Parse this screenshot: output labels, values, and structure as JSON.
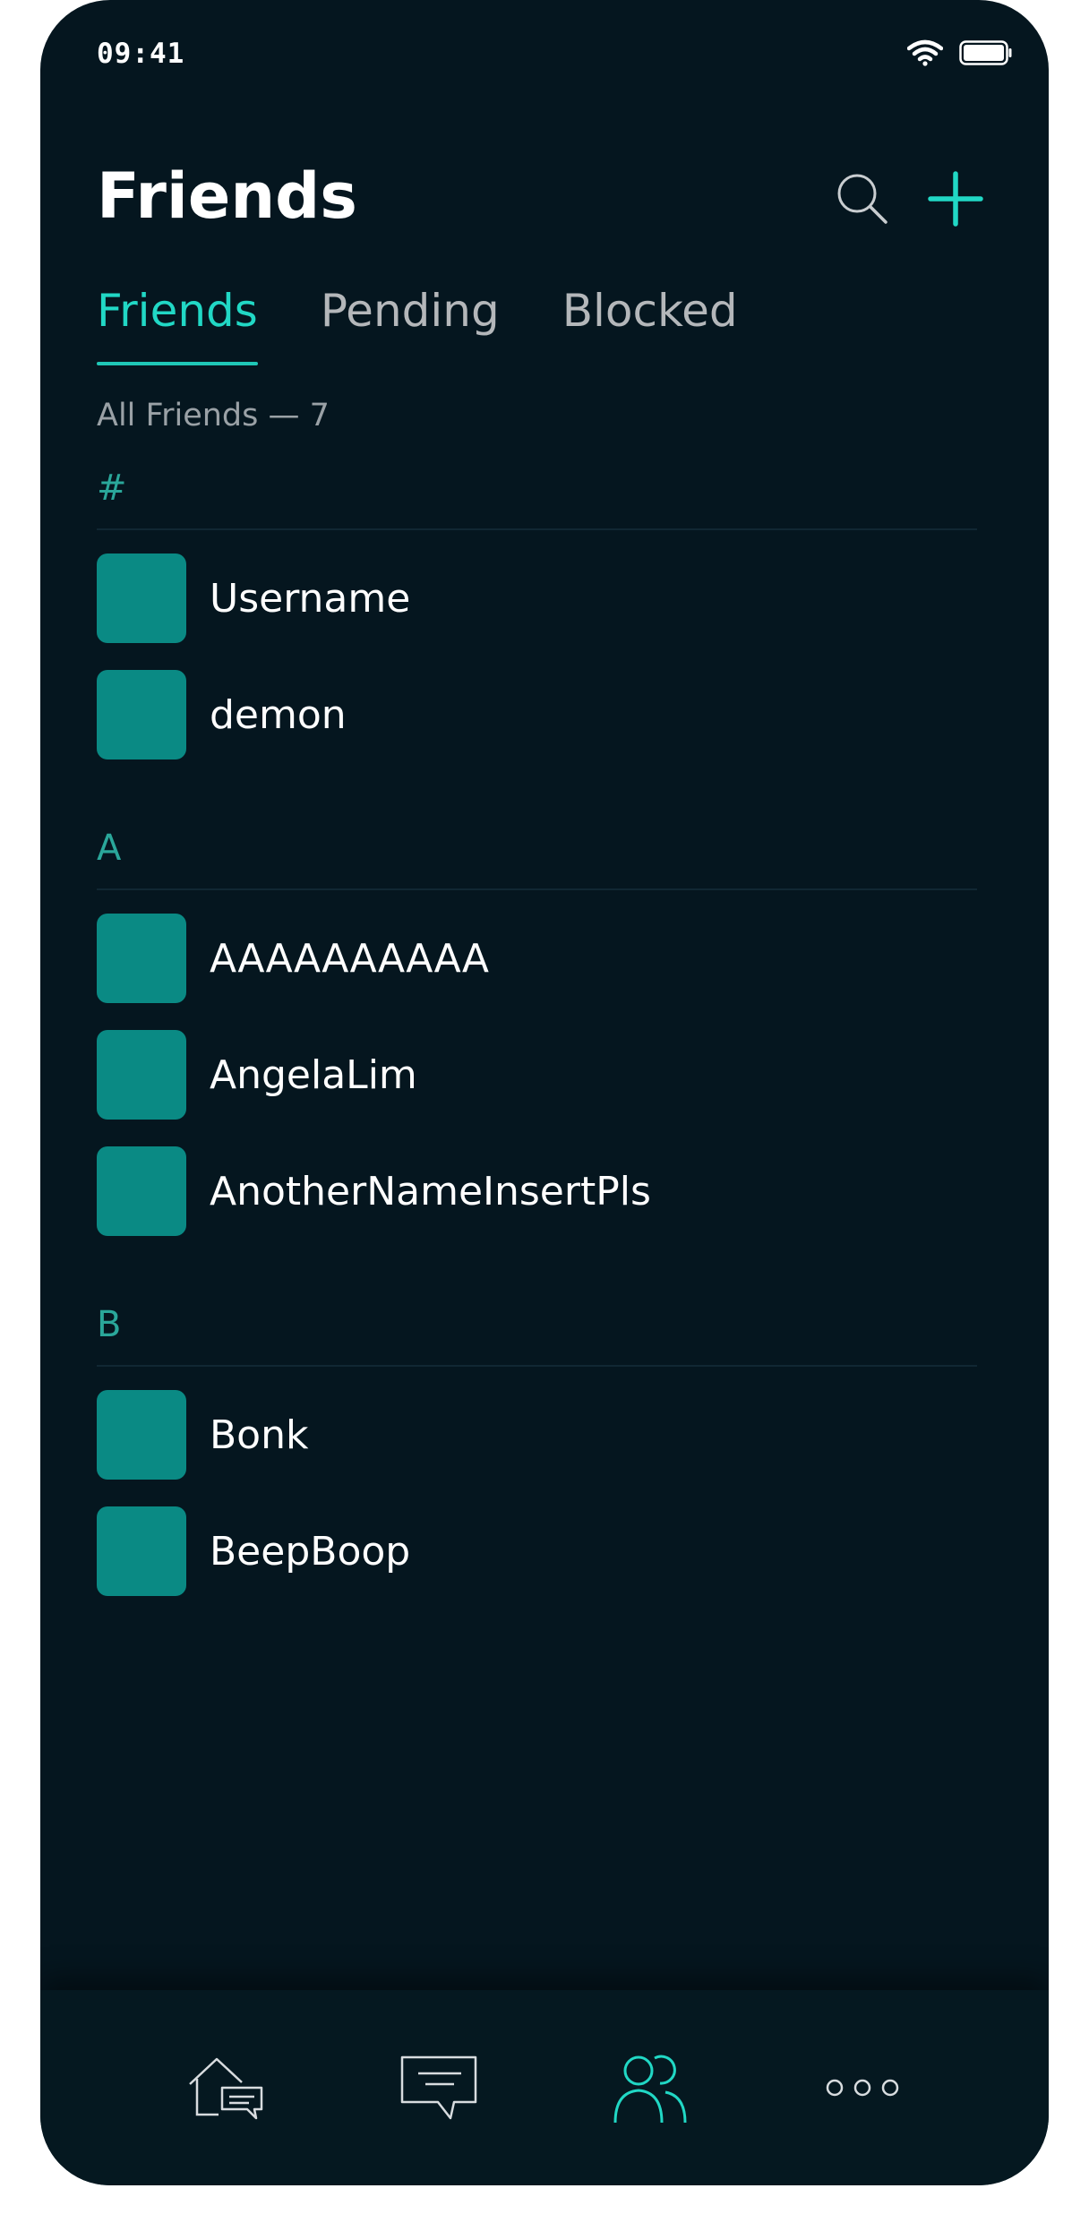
{
  "status_bar": {
    "time": "09:41"
  },
  "header": {
    "title": "Friends"
  },
  "tabs": [
    {
      "label": "Friends",
      "active": true
    },
    {
      "label": "Pending",
      "active": false
    },
    {
      "label": "Blocked",
      "active": false
    }
  ],
  "count_label": "All Friends — 7",
  "groups": [
    {
      "letter": "#",
      "friends": [
        {
          "name": "Username"
        },
        {
          "name": "demon"
        }
      ]
    },
    {
      "letter": "A",
      "friends": [
        {
          "name": "AAAAAAAAAA"
        },
        {
          "name": "AngelaLim"
        },
        {
          "name": "AnotherNameInsertPls"
        }
      ]
    },
    {
      "letter": "B",
      "friends": [
        {
          "name": "Bonk"
        },
        {
          "name": "BeepBoop"
        }
      ]
    }
  ],
  "bottom_nav": [
    {
      "icon": "home-chat-icon",
      "active": false
    },
    {
      "icon": "messages-icon",
      "active": false
    },
    {
      "icon": "friends-icon",
      "active": true
    },
    {
      "icon": "more-icon",
      "active": false
    }
  ],
  "colors": {
    "background": "#05161f",
    "accent": "#21d8c5",
    "avatar": "#0a8a84",
    "group_letter": "#2aa79a"
  }
}
